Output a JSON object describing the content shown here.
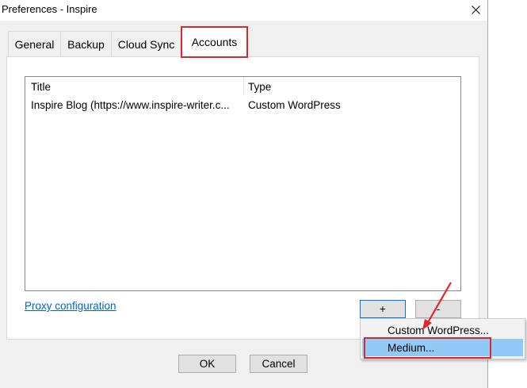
{
  "window": {
    "title": "Preferences - Inspire"
  },
  "tabs": [
    {
      "label": "General"
    },
    {
      "label": "Backup"
    },
    {
      "label": "Cloud Sync"
    },
    {
      "label": "Accounts"
    }
  ],
  "active_tab": "Accounts",
  "accounts_table": {
    "columns": [
      "Title",
      "Type"
    ],
    "rows": [
      {
        "title": "Inspire Blog (https://www.inspire-writer.c...",
        "type": "Custom WordPress"
      }
    ]
  },
  "proxy_link": "Proxy configuration",
  "add_button": "+",
  "remove_button": "-",
  "add_menu": {
    "items": [
      {
        "label": "Custom WordPress..."
      },
      {
        "label": "Medium..."
      }
    ],
    "hovered": "Medium..."
  },
  "footer": {
    "ok_label": "OK",
    "cancel_label": "Cancel"
  },
  "colors": {
    "annotation_red": "#e0262d",
    "link_blue": "#0066cc",
    "menu_hover": "#91c9f7"
  }
}
